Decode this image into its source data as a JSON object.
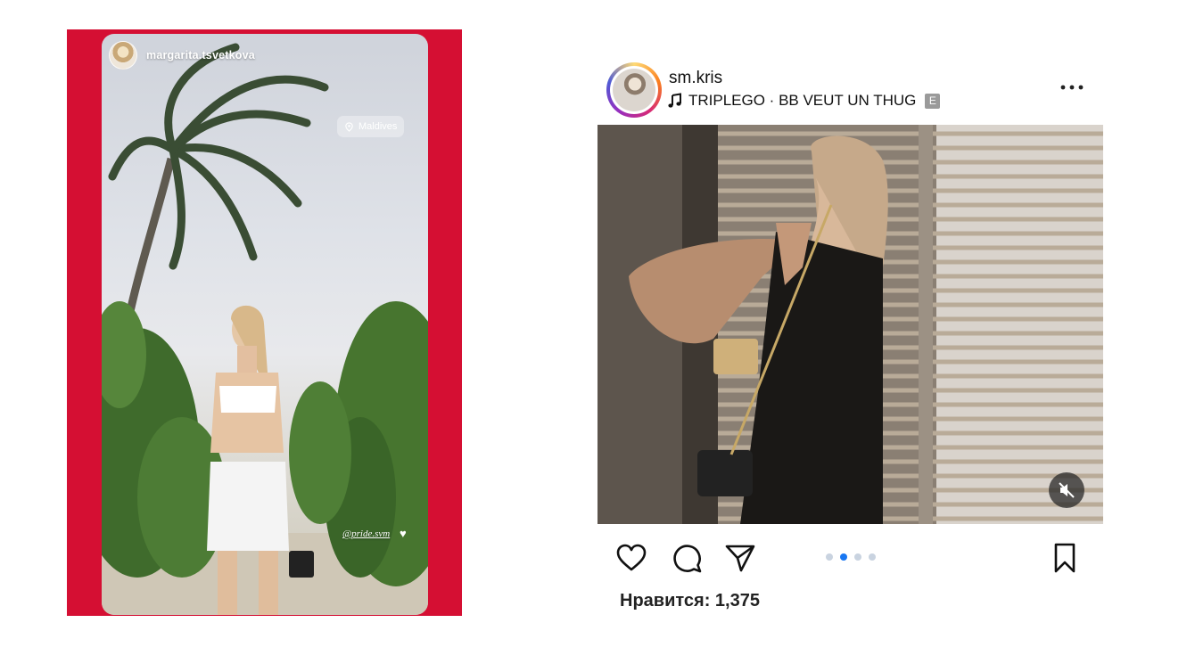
{
  "story": {
    "username": "margarita.tsvetkova",
    "location": "Maldives",
    "mention": "@pride.svm",
    "heart": "♥",
    "icons": [
      "avatar",
      "location-pin-icon"
    ]
  },
  "post": {
    "username": "sm.kris",
    "music": "TRIPLEGO · BB VEUT UN THUG",
    "explicit": "E",
    "likes": "Нравится: 1,375",
    "carousel": {
      "count": 4,
      "active_index": 1
    },
    "icons": [
      "more-icon",
      "music-note-icon",
      "mute-icon",
      "heart-icon",
      "comment-icon",
      "share-icon",
      "bookmark-icon"
    ]
  },
  "colors": {
    "story_frame": "#d50f33",
    "carousel_active": "#1877f2",
    "carousel_inactive": "#c9d3e0"
  }
}
